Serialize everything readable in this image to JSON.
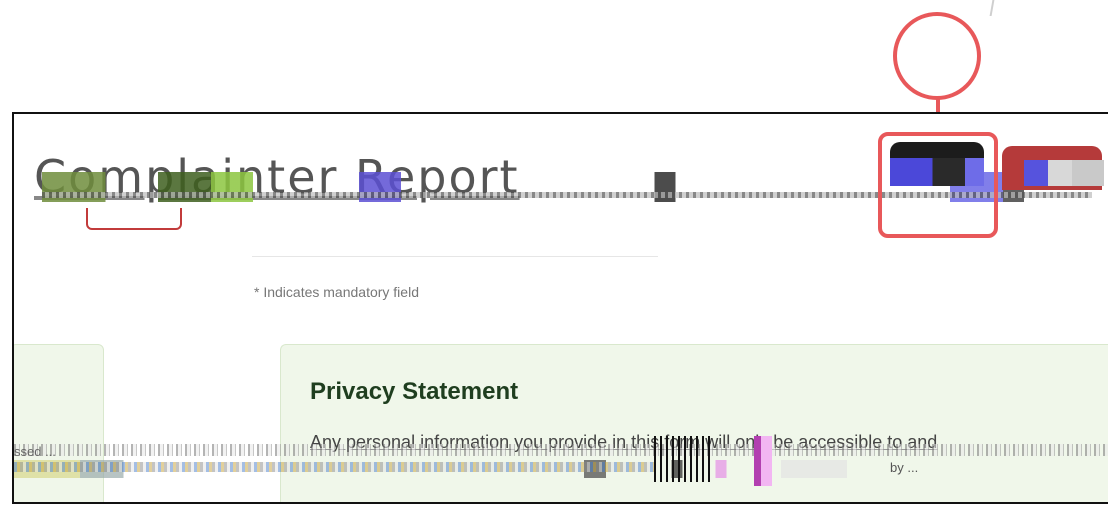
{
  "header": {
    "page_title": "Complainter Report",
    "callout_target_label": "",
    "secondary_button_label": ""
  },
  "form": {
    "mandatory_note": "* Indicates mandatory field"
  },
  "privacy": {
    "title": "Privacy Statement",
    "body": "Any personal information you provide in this form will only be accessible to and"
  },
  "snippets": {
    "left": "ssed ...",
    "right": "by ..."
  },
  "colors": {
    "callout": "#e8585a",
    "panel_bg": "#f0f7ea",
    "title_dark": "#1f3e1f",
    "accent_red": "#b53a3a"
  }
}
